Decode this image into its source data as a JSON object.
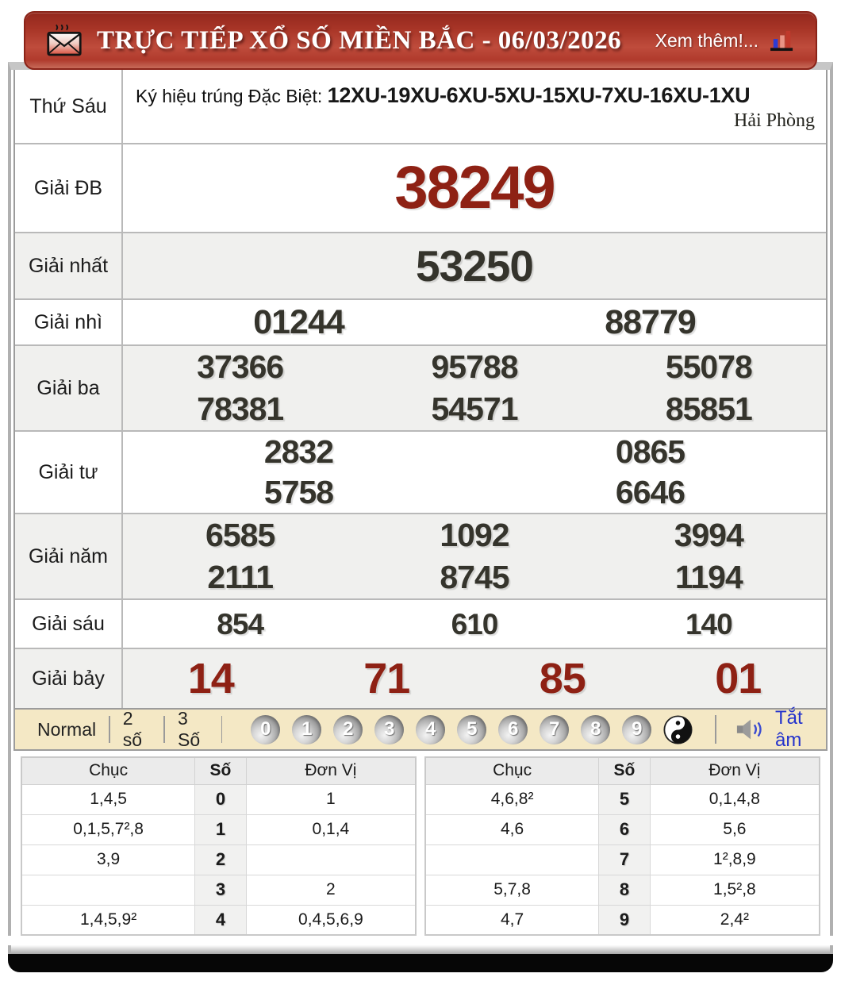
{
  "header": {
    "title": "TRỰC TIẾP XỔ SỐ MIỀN BẮC - 06/03/2026",
    "more_label": "Xem thêm!..."
  },
  "results": {
    "day_label": "Thứ Sáu",
    "sign_prefix": "Ký hiệu trúng Đặc Biệt: ",
    "sign_codes": "12XU-19XU-6XU-5XU-15XU-7XU-16XU-1XU",
    "province": "Hải Phòng",
    "rows": [
      {
        "key": "db",
        "label": "Giải ĐB",
        "lines": [
          [
            "38249"
          ]
        ]
      },
      {
        "key": "first",
        "label": "Giải nhất",
        "lines": [
          [
            "53250"
          ]
        ]
      },
      {
        "key": "second",
        "label": "Giải nhì",
        "lines": [
          [
            "01244",
            "88779"
          ]
        ]
      },
      {
        "key": "third",
        "label": "Giải ba",
        "lines": [
          [
            "37366",
            "95788",
            "55078"
          ],
          [
            "78381",
            "54571",
            "85851"
          ]
        ]
      },
      {
        "key": "fourth",
        "label": "Giải tư",
        "lines": [
          [
            "2832",
            "0865"
          ],
          [
            "5758",
            "6646"
          ]
        ]
      },
      {
        "key": "fifth",
        "label": "Giải năm",
        "lines": [
          [
            "6585",
            "1092",
            "3994"
          ],
          [
            "2111",
            "8745",
            "1194"
          ]
        ]
      },
      {
        "key": "sixth",
        "label": "Giải sáu",
        "lines": [
          [
            "854",
            "610",
            "140"
          ]
        ]
      },
      {
        "key": "seventh",
        "label": "Giải bảy",
        "lines": [
          [
            "14",
            "71",
            "85",
            "01"
          ]
        ]
      }
    ]
  },
  "controls": {
    "modes": [
      "Normal",
      "2 số",
      "3 Số"
    ],
    "balls": [
      "0",
      "1",
      "2",
      "3",
      "4",
      "5",
      "6",
      "7",
      "8",
      "9"
    ],
    "mute_label": "Tắt âm"
  },
  "summary": {
    "headers": [
      "Chục",
      "Số",
      "Đơn Vị"
    ],
    "left_rows": [
      [
        "1,4,5",
        "0",
        "1"
      ],
      [
        "0,1,5,7²,8",
        "1",
        "0,1,4"
      ],
      [
        "3,9",
        "2",
        ""
      ],
      [
        "",
        "3",
        "2"
      ],
      [
        "1,4,5,9²",
        "4",
        "0,4,5,6,9"
      ]
    ],
    "right_rows": [
      [
        "4,6,8²",
        "5",
        "0,1,4,8"
      ],
      [
        "4,6",
        "6",
        "5,6"
      ],
      [
        "",
        "7",
        "1²,8,9"
      ],
      [
        "5,7,8",
        "8",
        "1,5²,8"
      ],
      [
        "4,7",
        "9",
        "2,4²"
      ]
    ]
  },
  "colors": {
    "accent_red": "#8e2114",
    "header_red": "#b03a2c",
    "panel_cream": "#f4e8c5",
    "link_blue": "#2433cc"
  }
}
